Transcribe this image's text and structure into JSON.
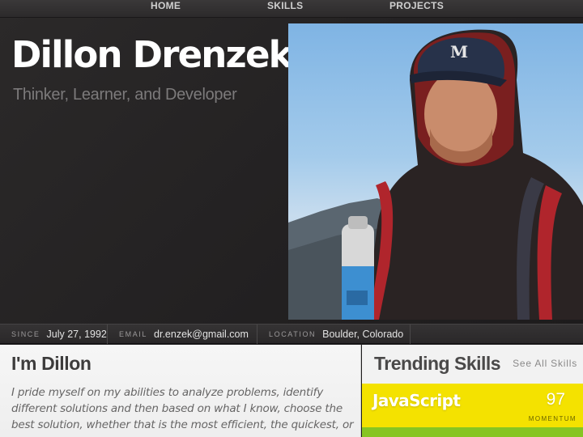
{
  "nav": {
    "items": [
      {
        "label": "HOME"
      },
      {
        "label": "SKILLS"
      },
      {
        "label": "PROJECTS"
      }
    ]
  },
  "hero": {
    "name": "Dillon Drenzek",
    "tagline": "Thinker, Learner, and Developer"
  },
  "info": {
    "since_label": "SINCE",
    "since_value": "July 27, 1992",
    "email_label": "EMAIL",
    "email_value": "dr.enzek@gmail.com",
    "location_label": "LOCATION",
    "location_value": "Boulder, Colorado"
  },
  "about": {
    "title": "I'm Dillon",
    "text": "I pride myself on my abilities to analyze problems, identify different solutions and then based on what I know, choose the best solution, whether that is the most efficient, the quickest, or"
  },
  "trending": {
    "title": "Trending Skills",
    "see_all": "See All Skills",
    "skills": [
      {
        "name": "JavaScript",
        "value": "97",
        "metric": "MOMENTUM",
        "color": "#f4e200"
      }
    ],
    "next_card_color": "#86c522"
  },
  "colors": {
    "background": "#232122",
    "about_bg": "#f2f2f2",
    "javascript": "#f4e200"
  }
}
